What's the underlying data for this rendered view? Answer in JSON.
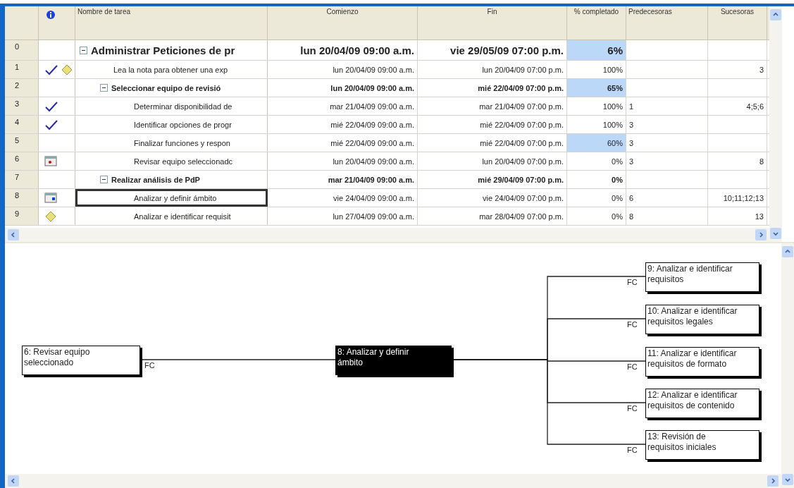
{
  "table": {
    "columns": [
      {
        "label": "Nombre de tarea"
      },
      {
        "label": "Comienzo"
      },
      {
        "label": "Fin"
      },
      {
        "label": "% completado"
      },
      {
        "label": "Predecesoras"
      },
      {
        "label": "Sucesoras"
      }
    ],
    "rows": [
      {
        "id": "0",
        "name": "Administrar Peticiones de pr",
        "summary": true,
        "expanded": true,
        "selected": false,
        "start": "lun 20/04/09 09:00 a.m.",
        "end": "vie 29/05/09 07:00 p.m.",
        "percent": "6%",
        "highlighted": true,
        "children": [
          {
            "id": "1",
            "indicators": [
              {
                "kind": "check"
              },
              {
                "kind": "note"
              }
            ],
            "name": "Lea la nota para obtener una exp",
            "summary": false,
            "selected": false,
            "start": "lun 20/04/09 09:00 a.m.",
            "end": "lun 20/04/09 07:00 p.m.",
            "percent": "100%",
            "highlighted": false,
            "successors": "3"
          },
          {
            "id": "2",
            "name": "Seleccionar equipo de revisió",
            "summary": true,
            "expanded": true,
            "selected": false,
            "start": "lun 20/04/09 09:00 a.m.",
            "end": "mié 22/04/09 07:00 p.m.",
            "percent": "65%",
            "highlighted": true,
            "children": [
              {
                "id": "3",
                "indicators": [
                  {
                    "kind": "check"
                  }
                ],
                "name": "Determinar disponibilidad de",
                "summary": false,
                "selected": false,
                "start": "mar 21/04/09 09:00 a.m.",
                "end": "mar 21/04/09 07:00 p.m.",
                "percent": "100%",
                "highlighted": false,
                "predecessors": "1",
                "successors": "4;5;6"
              },
              {
                "id": "4",
                "indicators": [
                  {
                    "kind": "check"
                  }
                ],
                "name": "Identificar opciones de progr",
                "summary": false,
                "selected": false,
                "start": "mié 22/04/09 09:00 a.m.",
                "end": "mié 22/04/09 07:00 p.m.",
                "percent": "100%",
                "highlighted": false,
                "predecessors": "3"
              },
              {
                "id": "5",
                "name": "Finalizar funciones y respon",
                "summary": false,
                "selected": false,
                "start": "mié 22/04/09 09:00 a.m.",
                "end": "mié 22/04/09 07:00 p.m.",
                "percent": "60%",
                "highlighted": true,
                "predecessors": "3"
              },
              {
                "id": "6",
                "indicators": [
                  {
                    "kind": "event"
                  }
                ],
                "name": "Revisar equipo seleccionadc",
                "summary": false,
                "selected": false,
                "start": "lun 20/04/09 09:00 a.m.",
                "end": "lun 20/04/09 07:00 p.m.",
                "percent": "0%",
                "highlighted": false,
                "predecessors": "3",
                "successors": "8"
              }
            ]
          },
          {
            "id": "7",
            "name": "Realizar análisis de PdP",
            "summary": true,
            "expanded": true,
            "selected": false,
            "start": "mar 21/04/09 09:00 a.m.",
            "end": "mié 29/04/09 07:00 p.m.",
            "percent": "0%",
            "highlighted": false,
            "children": [
              {
                "id": "8",
                "indicators": [
                  {
                    "kind": "constraint"
                  }
                ],
                "name": "Analizar y definir ámbito",
                "summary": false,
                "selected": true,
                "start": "vie 24/04/09 09:00 a.m.",
                "end": "vie 24/04/09 07:00 p.m.",
                "percent": "0%",
                "highlighted": false,
                "predecessors": "6",
                "successors": "10;11;12;13"
              },
              {
                "id": "9",
                "indicators": [
                  {
                    "kind": "note"
                  }
                ],
                "name": "Analizar e identificar requisit",
                "summary": false,
                "selected": false,
                "start": "lun 27/04/09 09:00 a.m.",
                "end": "mar 28/04/09 07:00 p.m.",
                "percent": "0%",
                "highlighted": false,
                "predecessors": "8",
                "successors": "13"
              }
            ]
          }
        ]
      }
    ]
  },
  "network": {
    "nodes": [
      {
        "label": "6: Revisar equipo seleccionado",
        "selected": false
      },
      {
        "label": "8: Analizar y definir ámbito",
        "selected": true
      },
      {
        "label": "9: Analizar e identificar requisitos",
        "selected": false
      },
      {
        "label": "10: Analizar e identificar requisitos legales",
        "selected": false
      },
      {
        "label": "11: Analizar e identificar requisitos de formato",
        "selected": false
      },
      {
        "label": "12: Analizar e identificar requisitos de contenido",
        "selected": false
      },
      {
        "label": "13: Revisión de requisitos iniciales",
        "selected": false
      }
    ],
    "links": [
      {
        "label": "FC"
      },
      {
        "label": "FC"
      },
      {
        "label": "FC"
      },
      {
        "label": "FC"
      },
      {
        "label": "FC"
      },
      {
        "label": "FC"
      }
    ]
  }
}
